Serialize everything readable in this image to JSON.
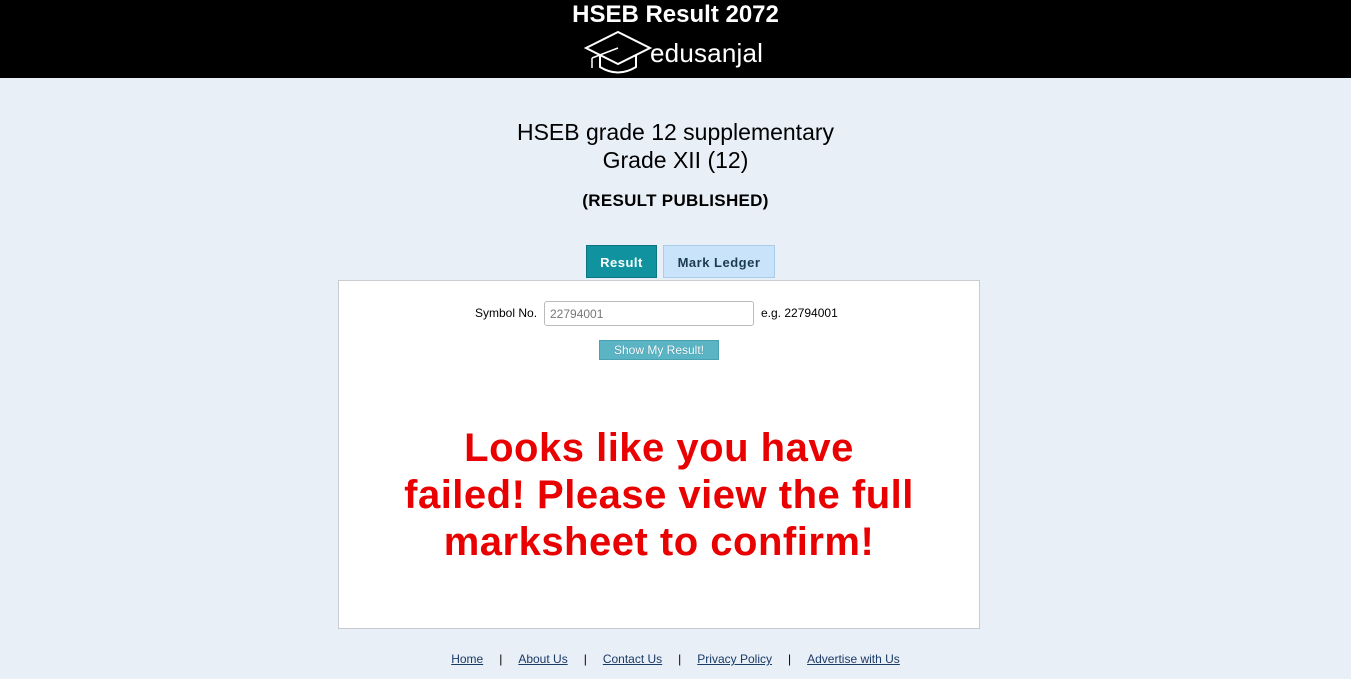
{
  "header": {
    "site_title": "HSEB Result 2072",
    "logo_text": "edusanjal",
    "logo_icon": "graduation-cap-icon"
  },
  "page": {
    "title_line1": "HSEB grade 12 supplementary",
    "title_line2": "Grade XII (12)",
    "status": "(RESULT PUBLISHED)"
  },
  "tabs": [
    {
      "label": "Result",
      "active": true
    },
    {
      "label": "Mark Ledger",
      "active": false
    }
  ],
  "form": {
    "symbol_label": "Symbol No.",
    "symbol_placeholder": "22794001",
    "example": "e.g. 22794001",
    "submit_label": "Show My Result!"
  },
  "result_message": "Looks like you have failed! Please view the full marksheet to confirm!",
  "footer": {
    "links": [
      "Home",
      "About Us",
      "Contact Us",
      "Privacy Policy",
      "Advertise with Us"
    ],
    "separator": "|"
  },
  "colors": {
    "header_bg": "#000000",
    "page_bg": "#e8eff7",
    "active_tab": "#11939f",
    "inactive_tab": "#c9e4fa",
    "message": "#e90000",
    "button": "#5bb4c4"
  }
}
